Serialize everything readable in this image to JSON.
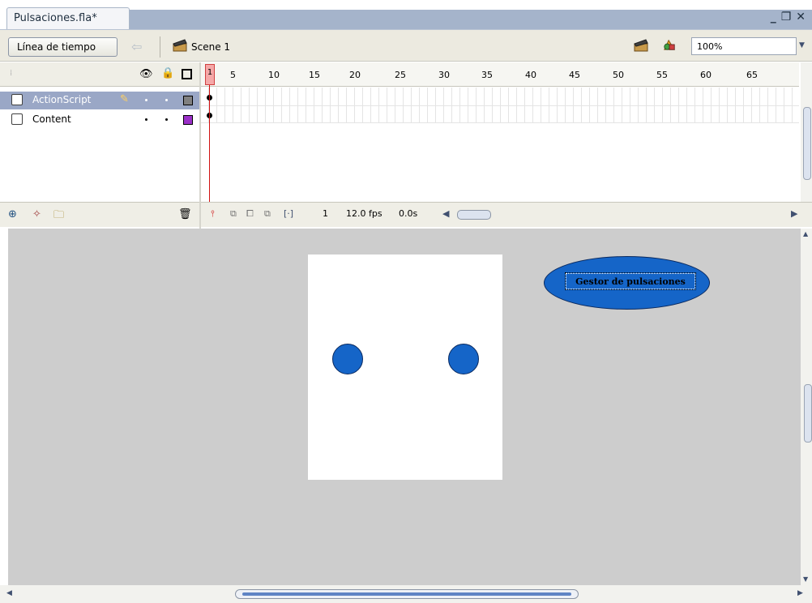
{
  "document_tab": {
    "title": "Pulsaciones.fla*"
  },
  "window_controls": {
    "minimize": "_",
    "restore": "❐",
    "close": "✕"
  },
  "toolbar": {
    "timeline_button": "Línea de tiempo",
    "scene_label": "Scene 1",
    "zoom_value": "100%"
  },
  "timeline": {
    "frame_numbers": [
      "1",
      "5",
      "10",
      "15",
      "20",
      "25",
      "30",
      "35",
      "40",
      "45",
      "50",
      "55",
      "60",
      "65"
    ],
    "layers": [
      {
        "name": "ActionScript",
        "color": "#808080",
        "selected": true
      },
      {
        "name": "Content",
        "color": "#9b30c8",
        "selected": false
      }
    ],
    "current_frame": "1",
    "frame_rate": "12.0 fps",
    "elapsed_time": "0.0s"
  },
  "stage": {
    "button_label": "Gestor de pulsaciones",
    "accent_color": "#1565c8"
  }
}
